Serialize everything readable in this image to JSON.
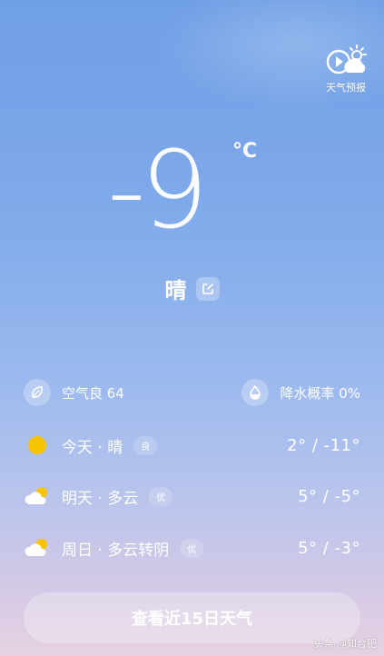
{
  "header": {
    "forecast_label": "天气预报",
    "forecast_icon": "play-cloud-sun-icon"
  },
  "current": {
    "temperature": "-9",
    "unit": "°C",
    "condition": "晴"
  },
  "info": {
    "air_quality": "空气良 64",
    "precipitation": "降水概率 0%"
  },
  "days": [
    {
      "label": "今天 · 晴",
      "aqi": "良",
      "temps": "2° / -11°",
      "icon": "sun-icon"
    },
    {
      "label": "明天 · 多云",
      "aqi": "优",
      "temps": "5° / -5°",
      "icon": "partly-cloudy-icon"
    },
    {
      "label": "周日 · 多云转阴",
      "aqi": "优",
      "temps": "5° / -3°",
      "icon": "partly-cloudy-icon"
    }
  ],
  "cta": {
    "label": "查看近15日天气"
  },
  "watermark": "头条 @知合肥",
  "colors": {
    "sun": "#f7c500",
    "bg_top": "#6f9fe6",
    "bg_bottom": "#e6d2e1"
  }
}
